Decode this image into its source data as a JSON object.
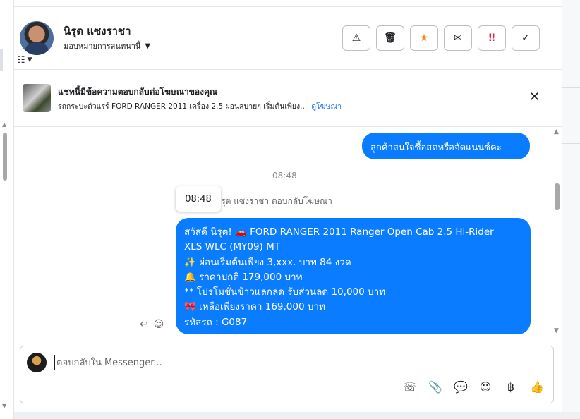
{
  "header": {
    "contact_name": "นิรุต แซงราชา",
    "assign_label": "มอบหมายการสนทนานี้",
    "actions": [
      {
        "name": "report-button",
        "glyph": "⚠"
      },
      {
        "name": "delete-button",
        "glyph": "🗑"
      },
      {
        "name": "star-button",
        "glyph": "★"
      },
      {
        "name": "mark-unread-button",
        "glyph": "✉"
      },
      {
        "name": "priority-button",
        "glyph": "‼"
      },
      {
        "name": "done-button",
        "glyph": "✓"
      }
    ]
  },
  "ad_banner": {
    "title": "แชทนี้มีข้อความตอบกลับต่อโฆษณาของคุณ",
    "description": "รถกระบะตัวแรร์ FORD RANGER 2011 เครื่อง 2.5 ผ่อนสบายๆ เริ่มต้นเพียง...",
    "link_label": "ดูโฆษณา"
  },
  "chat": {
    "outgoing_message_1": "ลูกค้าสนใจซื้อสดหรือจัดแนนซ์คะ",
    "time_center": "08:48",
    "tooltip_time": "08:48",
    "reply_note": "นิรุต แซงราชา ตอบกลับโฆษณา",
    "ad_reply_message": {
      "lines": [
        "สวัสดี นิรุต! 🚗  FORD RANGER 2011 Ranger Open Cab 2.5 Hi-Rider",
        "XLS WLC (MY09) MT",
        "✨  ผ่อนเริ่มต้นเพียง 3,xxx. บาท 84 งวด",
        "🔔 ราคาปกติ 179,000 บาท",
        "** โปรโมชั่นข้าวแลกลด รับส่วนลด 10,000 บาท",
        "🎀  เหลือเพียงราคา 169,000 บาท",
        " รหัสรถ : G087"
      ]
    }
  },
  "composer": {
    "placeholder": "ตอบกลับใน Messenger...",
    "tools": [
      {
        "name": "add-call-icon",
        "glyph": "☏"
      },
      {
        "name": "attach-icon",
        "glyph": "📎"
      },
      {
        "name": "saved-reply-icon",
        "glyph": "💬"
      },
      {
        "name": "emoji-icon",
        "glyph": "☺"
      },
      {
        "name": "payment-icon",
        "glyph": "฿"
      },
      {
        "name": "thumbs-up-icon",
        "glyph": "👍"
      }
    ]
  }
}
